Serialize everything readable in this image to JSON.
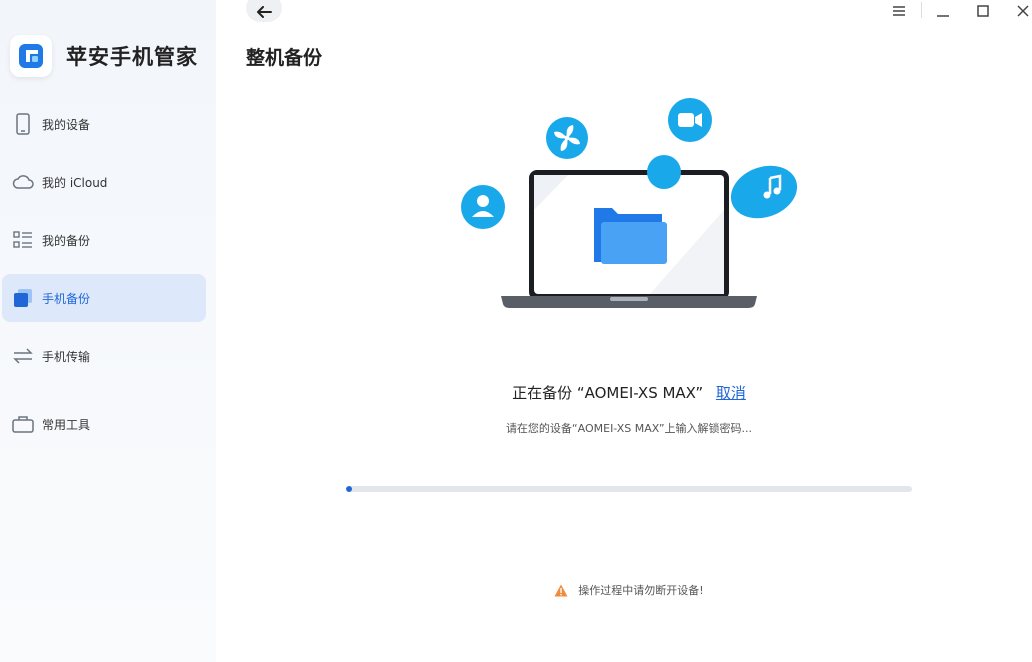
{
  "app": {
    "name": "苹安手机管家"
  },
  "sidebar": {
    "items": [
      {
        "label": "我的设备",
        "icon": "phone-icon"
      },
      {
        "label": "我的 iCloud",
        "icon": "cloud-icon"
      },
      {
        "label": "我的备份",
        "icon": "list-icon"
      },
      {
        "label": "手机备份",
        "icon": "backup-icon",
        "active": true
      },
      {
        "label": "手机传输",
        "icon": "transfer-icon"
      },
      {
        "label": "常用工具",
        "icon": "toolbox-icon"
      }
    ]
  },
  "header": {
    "title": "整机备份"
  },
  "backup": {
    "status_text": "正在备份 “AOMEI-XS MAX”",
    "cancel_label": "取消",
    "hint_text": "请在您的设备“AOMEI-XS MAX”上输入解锁密码...",
    "progress_percent": 1,
    "warning_text": "操作过程中请勿断开设备!"
  },
  "colors": {
    "accent": "#1f66d6",
    "icon_blue": "#19a9ea",
    "warning": "#f08a3c"
  }
}
